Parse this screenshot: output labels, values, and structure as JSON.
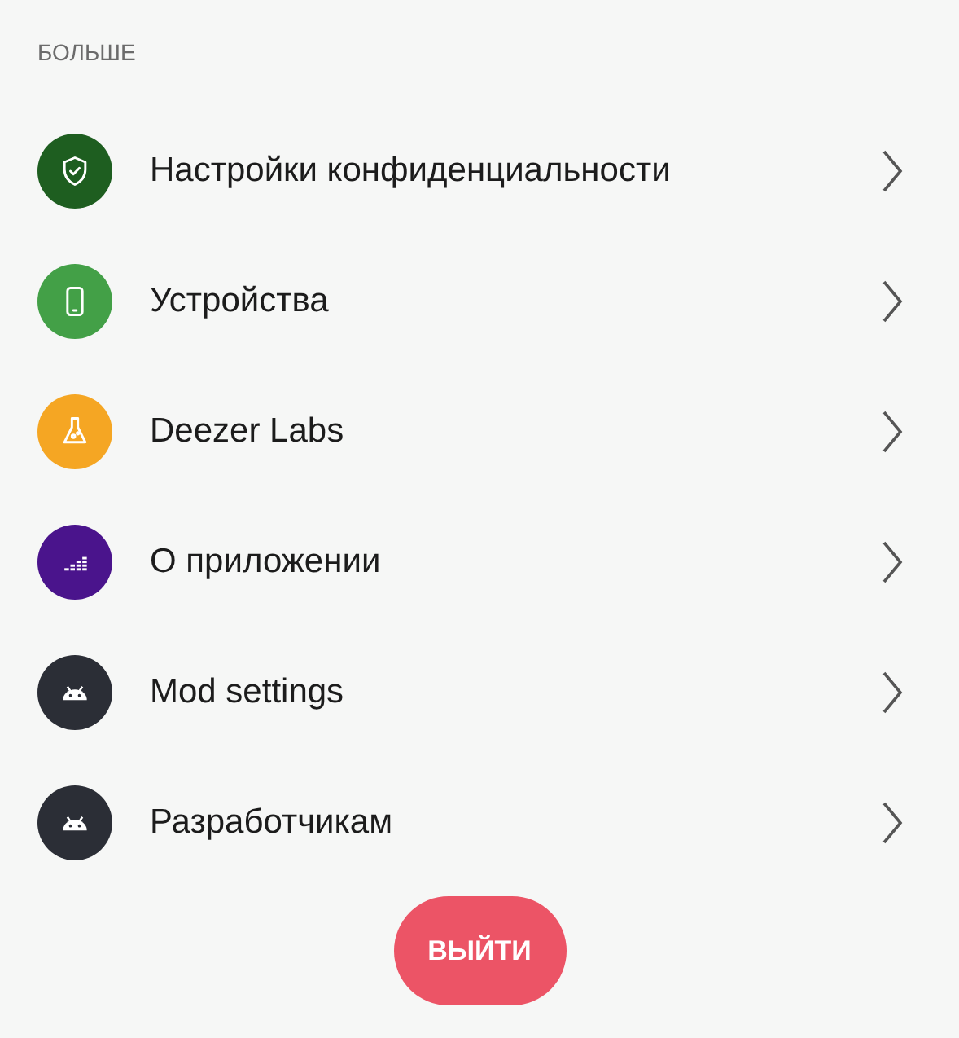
{
  "section": {
    "title": "БОЛЬШЕ"
  },
  "items": [
    {
      "label": "Настройки конфиденциальности",
      "color": "#1e5e20"
    },
    {
      "label": "Устройства",
      "color": "#43a047"
    },
    {
      "label": "Deezer Labs",
      "color": "#f5a623"
    },
    {
      "label": "О приложении",
      "color": "#4a148c"
    },
    {
      "label": "Mod settings",
      "color": "#2b2e36"
    },
    {
      "label": "Разработчикам",
      "color": "#2b2e36"
    }
  ],
  "logout_button": {
    "label": "ВЫЙТИ"
  }
}
